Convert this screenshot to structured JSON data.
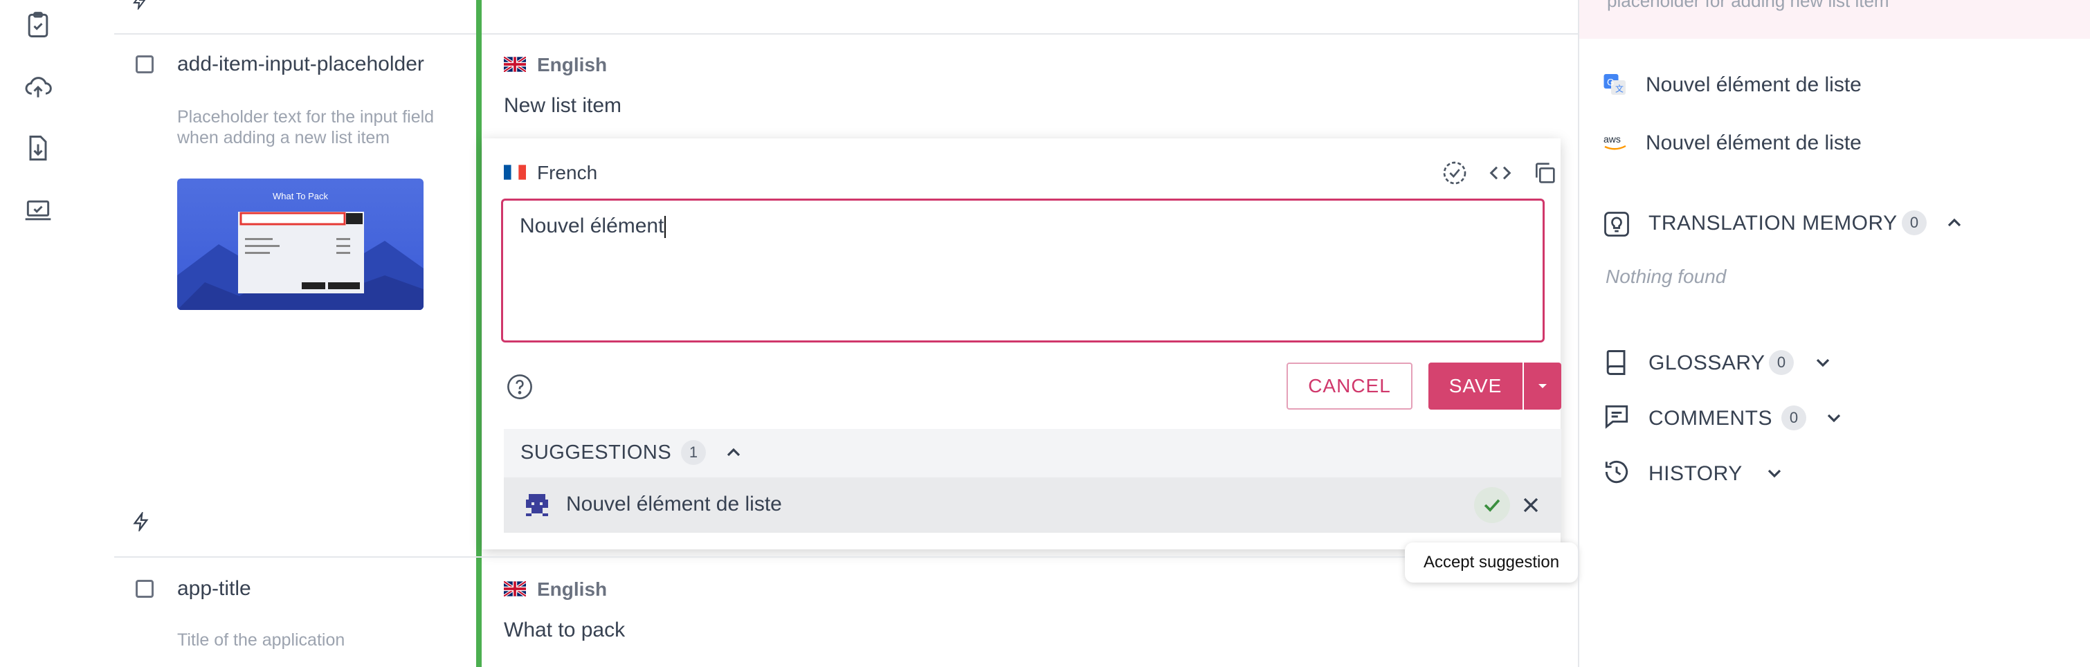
{
  "top_row": {
    "right_panel_partial_text": "placeholder for adding new list item"
  },
  "rows": [
    {
      "key": "add-item-input-placeholder",
      "description": "Placeholder text for the input field when adding a new list item",
      "base_language": "English",
      "base_text": "New list item"
    },
    {
      "key": "app-title",
      "description": "Title of the application",
      "base_language": "English",
      "base_text": "What to pack"
    }
  ],
  "screenshot_thumb": {
    "title": "What To Pack"
  },
  "editor": {
    "language": "French",
    "value": "Nouvel élément",
    "cancel_label": "CANCEL",
    "save_label": "SAVE",
    "suggestions_label": "SUGGESTIONS",
    "suggestions_count": "1",
    "suggestion_text": "Nouvel élément de liste",
    "accept_tooltip": "Accept suggestion"
  },
  "right_panel": {
    "machine_translations": [
      {
        "provider_icon": "google-translate-icon",
        "text": "Nouvel élément de liste"
      },
      {
        "provider_icon": "aws-icon",
        "text": "Nouvel élément de liste"
      }
    ],
    "translation_memory": {
      "label": "TRANSLATION MEMORY",
      "count": "0",
      "empty_text": "Nothing found"
    },
    "glossary": {
      "label": "GLOSSARY",
      "count": "0"
    },
    "comments": {
      "label": "COMMENTS",
      "count": "0"
    },
    "history": {
      "label": "HISTORY"
    }
  },
  "colors": {
    "accent": "#d5436f",
    "row_state_bar": "#4caf50"
  }
}
